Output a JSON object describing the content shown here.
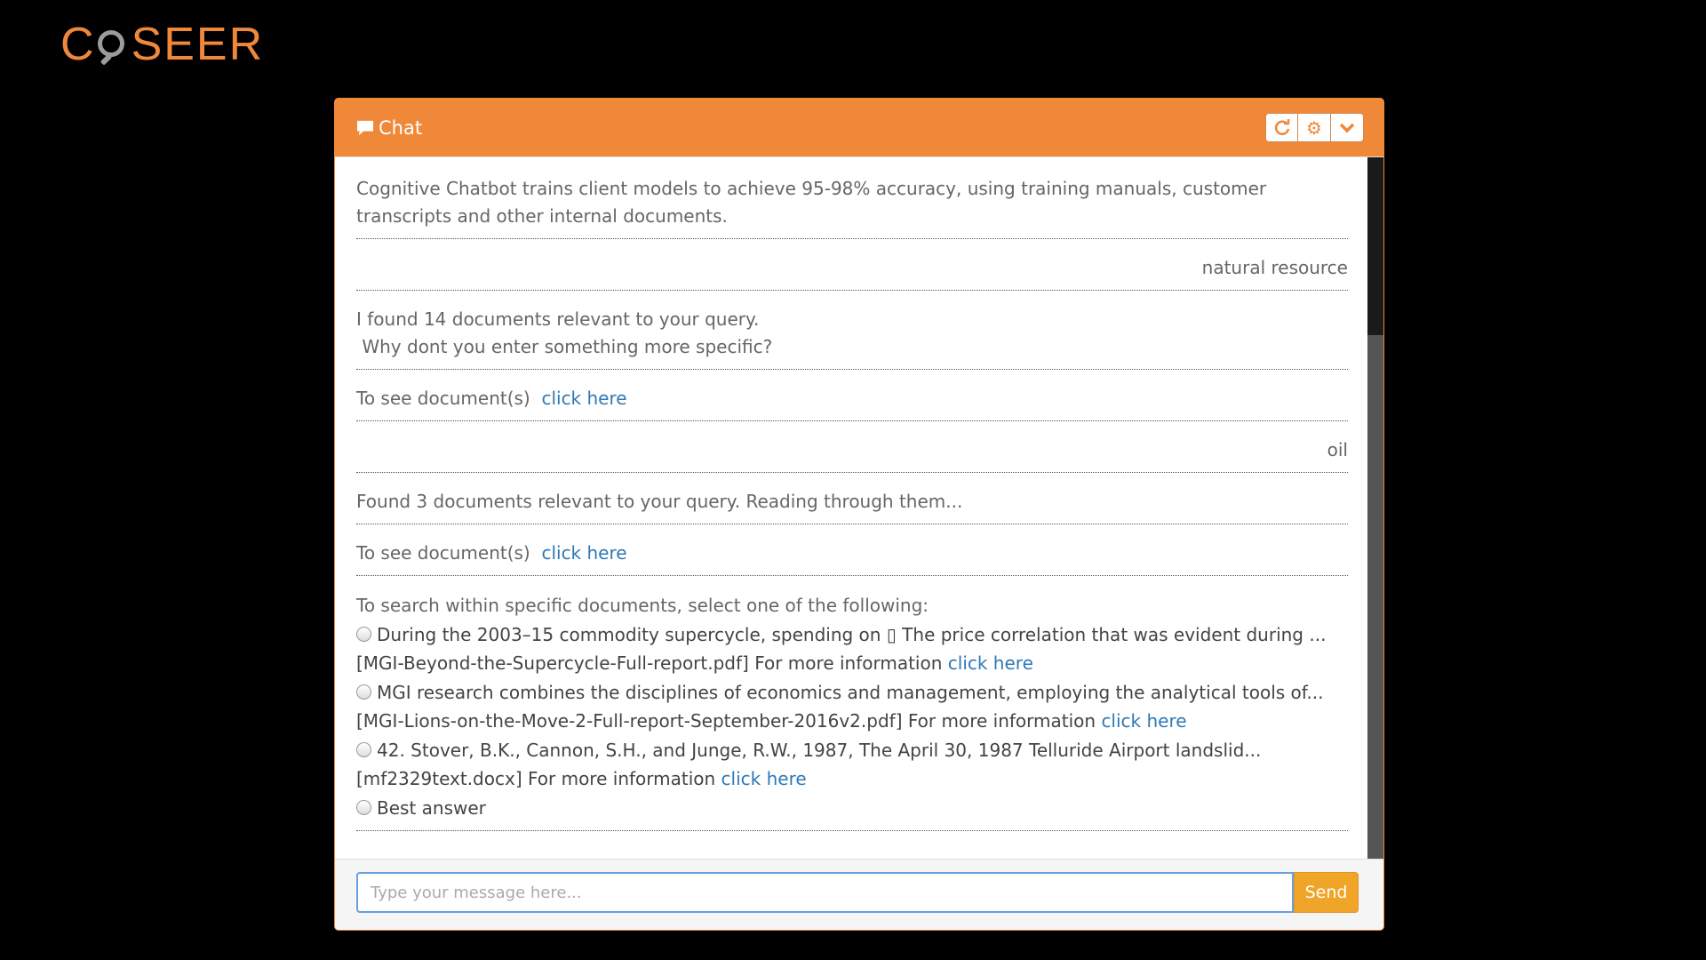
{
  "logo": {
    "text_before": "C",
    "text_after": "SEER"
  },
  "chat": {
    "title": "Chat",
    "header_icons": [
      "refresh-icon",
      "gear-icon",
      "chevron-down-icon"
    ]
  },
  "messages": {
    "intro": "Cognitive Chatbot trains client models to achieve 95-98% accuracy, using training manuals, customer transcripts and other internal documents.",
    "user1": "natural resource",
    "bot1_line1": "I found 14 documents relevant to your query.",
    "bot1_line2": "Why dont you enter something more specific?",
    "see_docs_prefix": "To see document(s)",
    "click_here": "click here",
    "user2": "oil",
    "bot2": "Found 3 documents relevant to your query. Reading through them...",
    "select_prompt": "To search within specific documents, select one of the following:",
    "more_info": "For more information",
    "options": [
      "During the 2003–15 commodity supercycle, spending on ▯ The price correlation that was evident during ...[MGI-Beyond-the-Supercycle-Full-report.pdf]",
      "MGI research combines the disciplines of economics and management, employing the analytical tools of...[MGI-Lions-on-the-Move-2-Full-report-September-2016v2.pdf]",
      "42. Stover, B.K., Cannon, S.H., and Junge, R.W., 1987, The April 30, 1987 Telluride Airport landslid...[mf2329text.docx]",
      "Best answer"
    ]
  },
  "input": {
    "placeholder": "Type your message here...",
    "send_label": "Send"
  },
  "colors": {
    "accent": "#f0883a",
    "send": "#f0a428",
    "link": "#3078b5"
  }
}
